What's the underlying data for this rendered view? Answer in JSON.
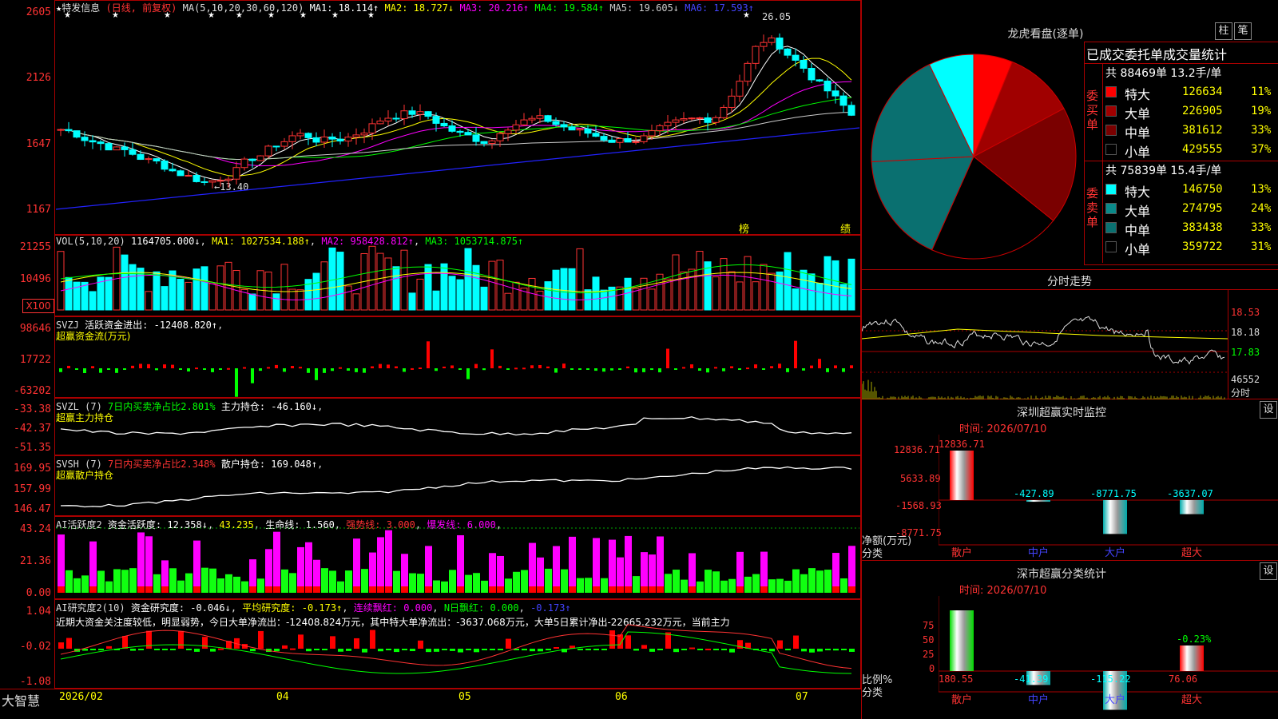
{
  "main": {
    "stock_name": "特发信息",
    "mode": "(日线, 前复权)",
    "ma_header": "MA(5,10,20,30,60,120)",
    "ma1": "MA1: 18.114↑",
    "ma2": "MA2: 18.727↓",
    "ma3": "MA3: 20.216↑",
    "ma4": "MA4: 19.584↑",
    "ma5": "MA5: 19.605↓",
    "ma6": "MA6: 17.593↑",
    "axis": [
      "2605",
      "2126",
      "1647",
      "1167"
    ],
    "high_label": "26.05",
    "low_label": "←13.40",
    "tag1": "榜",
    "tag2": "绩"
  },
  "vol": {
    "header": "VOL(5,10,20)",
    "value": "1164705.000↓",
    "ma1": "MA1: 1027534.188↑",
    "ma2": "MA2: 958428.812↑",
    "ma3": "MA3: 1053714.875↑",
    "axis": [
      "21255",
      "10496"
    ],
    "unit": "X100"
  },
  "svzj": {
    "header": "SVZJ",
    "text": "活跃资金进出: -12408.820↑",
    "sub": "超赢资金流(万元)",
    "axis": [
      "98646",
      "17722",
      "-63202"
    ]
  },
  "svzl": {
    "header": "SVZL (7)",
    "text1": "7日内买卖净占比2.801%",
    "text2": "主力持仓: -46.160↓",
    "sub": "超赢主力持仓",
    "axis": [
      "-33.38",
      "-42.37",
      "-51.35"
    ]
  },
  "svsh": {
    "header": "SVSH (7)",
    "text1": "7日内买卖净占比2.348%",
    "text2": "散户持仓: 169.048↑",
    "sub": "超赢散户持仓",
    "axis": [
      "169.95",
      "157.99",
      "146.47"
    ]
  },
  "ai1": {
    "header": "AI活跃度2",
    "text1": "资金活跃度: 12.358↓",
    "text2": "43.235",
    "text3": "生命线: 1.560",
    "text4": "强势线: 3.000",
    "text5": "爆发线: 6.000",
    "axis": [
      "43.24",
      "21.36",
      "0.00"
    ]
  },
  "ai2": {
    "header": "AI研究度2(10)",
    "text1": "资金研究度: -0.046↓",
    "text2": "平均研究度: -0.173↑",
    "text3": "连续飘红: 0.000",
    "text4": "N日飘红: 0.000",
    "text5": "-0.173↑",
    "comment": "近期大资金关注度较低，明显弱势，今日大单净流出：-12408.824万元，其中特大单净流出：-3637.068万元，大单5日累计净出-22665.232万元，当前主力",
    "axis": [
      "1.04",
      "-0.02",
      "-1.08"
    ]
  },
  "bottom": {
    "brand": "大智慧",
    "dates": [
      "2026/02",
      "04",
      "05",
      "06",
      "07"
    ]
  },
  "lhb": {
    "title": "龙虎看盘(逐单)",
    "btn1": "柱",
    "btn2": "笔",
    "stat_title": "已成交委托单成交量统计",
    "buy_label": "委买单",
    "buy_total": "共 88469单 13.2手/单",
    "sell_label": "委卖单",
    "sell_total": "共 75839单 15.4手/单",
    "buy_rows": [
      {
        "name": "特大",
        "val": "126634",
        "pct": "11%",
        "color": "#ff0000"
      },
      {
        "name": "大单",
        "val": "226905",
        "pct": "19%",
        "color": "#a00000"
      },
      {
        "name": "中单",
        "val": "381612",
        "pct": "33%",
        "color": "#7a0000"
      },
      {
        "name": "小单",
        "val": "429555",
        "pct": "37%",
        "color": "#000000"
      }
    ],
    "sell_rows": [
      {
        "name": "特大",
        "val": "146750",
        "pct": "13%",
        "color": "#00ffff"
      },
      {
        "name": "大单",
        "val": "274795",
        "pct": "24%",
        "color": "#0a8a8a"
      },
      {
        "name": "中单",
        "val": "383438",
        "pct": "33%",
        "color": "#0a7070"
      },
      {
        "name": "小单",
        "val": "359722",
        "pct": "31%",
        "color": "#000000"
      }
    ]
  },
  "fenshi": {
    "title": "分时走势",
    "axis": [
      "18.53",
      "18.18",
      "17.83"
    ],
    "vol_label": "46552",
    "unit": "分时"
  },
  "szmon": {
    "title": "深圳超赢实时监控",
    "btn": "设",
    "time": "时间: 2026/07/10",
    "axis": [
      "12836.71",
      "5633.89",
      "-1568.93",
      "-8771.75"
    ],
    "y_unit": "净额(万元)",
    "x_unit": "分类",
    "bars": [
      {
        "cat": "散户",
        "label": "12836.71",
        "value": 12836.71
      },
      {
        "cat": "中户",
        "label": "-427.89",
        "value": -427.89
      },
      {
        "cat": "大户",
        "label": "-8771.75",
        "value": -8771.75
      },
      {
        "cat": "超大",
        "label": "-3637.07",
        "value": -3637.07
      }
    ]
  },
  "szcls": {
    "title": "深市超赢分类统计",
    "btn": "设",
    "time": "时间: 2026/07/10",
    "axis": [
      "75",
      "50",
      "25",
      "0"
    ],
    "y_unit": "比例%",
    "x_unit": "分类",
    "bars": [
      {
        "cat": "散户",
        "label": "180.55",
        "value": 180.55
      },
      {
        "cat": "中户",
        "label": "-41.39",
        "value": -41.39
      },
      {
        "cat": "大户",
        "label": "-115.22",
        "value": -115.22
      },
      {
        "cat": "超大",
        "label": "76.06",
        "value": 76.06,
        "extra": "-0.23%"
      }
    ]
  }
}
